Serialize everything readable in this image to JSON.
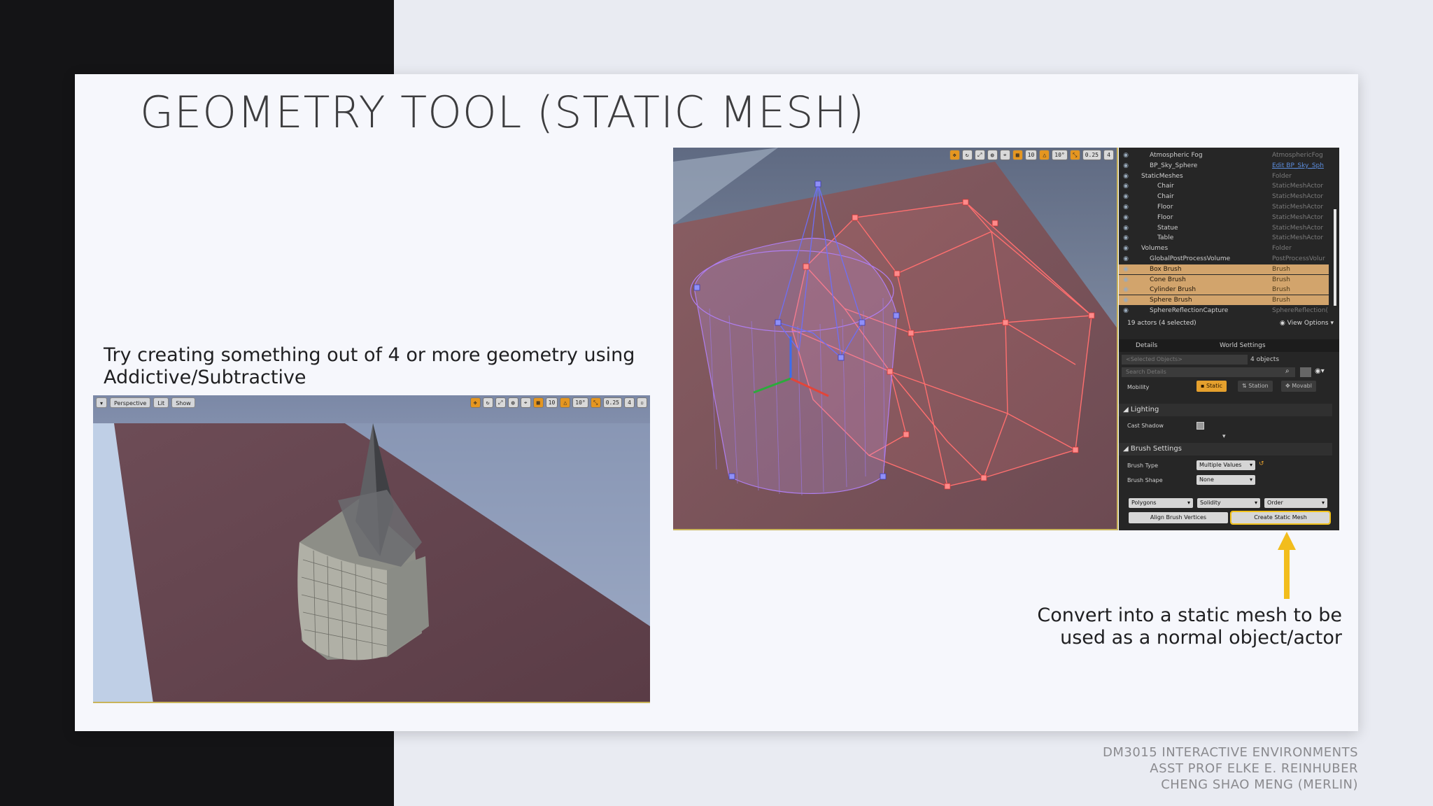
{
  "slide": {
    "title": "GEOMETRY TOOL (STATIC MESH)",
    "instruction_line1": "Try creating something out of 4 or more geometry using",
    "instruction_line2": "Addictive/Subtractive",
    "caption_line1": "Convert into a static mesh to be",
    "caption_line2": "used as a normal object/actor",
    "footer_line1": "DM3015 INTERACTIVE ENVIRONMENTS",
    "footer_line2": "ASST PROF ELKE E. REINHUBER",
    "footer_line3": "CHENG SHAO MENG (MERLIN)"
  },
  "viewport": {
    "perspective_label": "Perspective",
    "lit_label": "Lit",
    "show_label": "Show",
    "grid_snap": "10",
    "rotation_snap": "10°",
    "scale_snap": "0.25",
    "camera_speed": "4"
  },
  "outliner": {
    "rows": [
      {
        "name": "Atmospheric Fog",
        "type": "AtmosphericFog"
      },
      {
        "name": "BP_Sky_Sphere",
        "type": "Edit BP_Sky_Sph"
      },
      {
        "name": "StaticMeshes",
        "type": "Folder"
      },
      {
        "name": "Chair",
        "type": "StaticMeshActor"
      },
      {
        "name": "Chair",
        "type": "StaticMeshActor"
      },
      {
        "name": "Floor",
        "type": "StaticMeshActor"
      },
      {
        "name": "Floor",
        "type": "StaticMeshActor"
      },
      {
        "name": "Statue",
        "type": "StaticMeshActor"
      },
      {
        "name": "Table",
        "type": "StaticMeshActor"
      },
      {
        "name": "Volumes",
        "type": "Folder"
      },
      {
        "name": "GlobalPostProcessVolume",
        "type": "PostProcessVolur"
      },
      {
        "name": "Box Brush",
        "type": "Brush"
      },
      {
        "name": "Cone Brush",
        "type": "Brush"
      },
      {
        "name": "Cylinder Brush",
        "type": "Brush"
      },
      {
        "name": "Sphere Brush",
        "type": "Brush"
      },
      {
        "name": "SphereReflectionCapture",
        "type": "SphereReflection("
      }
    ],
    "status": "19 actors (4 selected)",
    "view_options": "View Options"
  },
  "details": {
    "tab_details": "Details",
    "tab_world_settings": "World Settings",
    "selected_objects_placeholder": "<Selected Objects>",
    "objects_count": "4 objects",
    "search_placeholder": "Search Details",
    "mobility_label": "Mobility",
    "mobility_static": "Static",
    "mobility_stationary": "Station",
    "mobility_movable": "Movabl",
    "lighting_section": "Lighting",
    "cast_shadow_label": "Cast Shadow",
    "brush_settings_section": "Brush Settings",
    "brush_type_label": "Brush Type",
    "brush_type_value": "Multiple Values",
    "brush_shape_label": "Brush Shape",
    "brush_shape_value": "None",
    "polygons": "Polygons",
    "solidity": "Solidity",
    "order": "Order",
    "align_brush_vertices": "Align Brush Vertices",
    "create_static_mesh": "Create Static Mesh"
  },
  "colors": {
    "accent_arrow": "#f2bd1d",
    "selection_row": "#d2a46c",
    "active_mobility": "#e5a02d"
  }
}
